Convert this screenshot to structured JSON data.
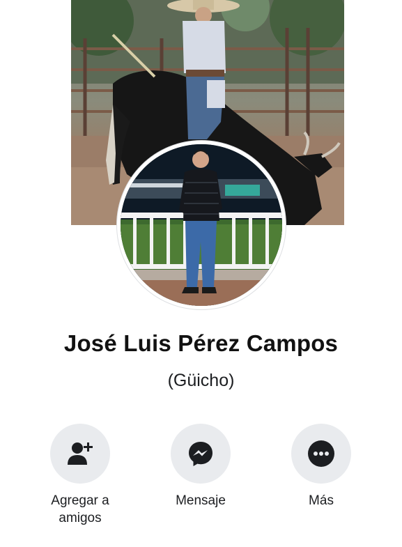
{
  "profile": {
    "name": "José Luis Pérez Campos",
    "nickname": "(Güicho)"
  },
  "actions": [
    {
      "label": "Agregar a amigos",
      "icon": "add-friend-icon"
    },
    {
      "label": "Mensaje",
      "icon": "messenger-icon"
    },
    {
      "label": "Más",
      "icon": "more-icon"
    }
  ],
  "colors": {
    "button_bg": "#e9ebee",
    "icon": "#1c1e21",
    "text": "#1c1e21"
  }
}
